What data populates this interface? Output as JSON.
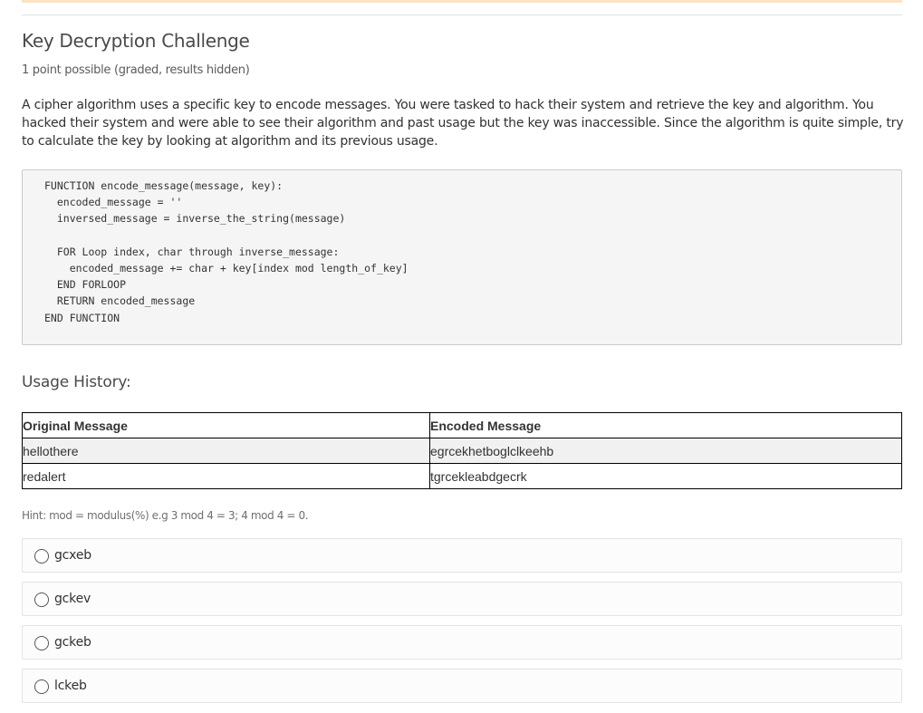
{
  "problem": {
    "title": "Key Decryption Challenge",
    "points": "1 point possible (graded, results hidden)",
    "description": "A cipher algorithm uses a specific key to encode messages. You were tasked to hack their system and retrieve the key and algorithm. You hacked their system and were able to see their algorithm and past usage but the key was inaccessible. Since the algorithm is quite simple, try to calculate the key by looking at algorithm and its previous usage."
  },
  "code": {
    "lines": [
      "FUNCTION encode_message(message, key):",
      "  encoded_message = ''",
      "  inversed_message = inverse_the_string(message)",
      "",
      "  FOR Loop index, char through inverse_message:",
      "    encoded_message += char + key[index mod length_of_key]",
      "  END FORLOOP",
      "  RETURN encoded_message",
      "END FUNCTION"
    ]
  },
  "usage": {
    "heading": "Usage History:",
    "columns": [
      "Original Message",
      "Encoded Message"
    ],
    "rows": [
      [
        "hellothere",
        "egrcekhetboglclkeehb"
      ],
      [
        "redalert",
        "tgrcekleabdgecrk"
      ]
    ]
  },
  "hint": "Hint: mod = modulus(%) e.g 3 mod 4 = 3; 4 mod 4 = 0.",
  "options": [
    "gcxeb",
    "gckev",
    "gckeb",
    "lckeb"
  ]
}
